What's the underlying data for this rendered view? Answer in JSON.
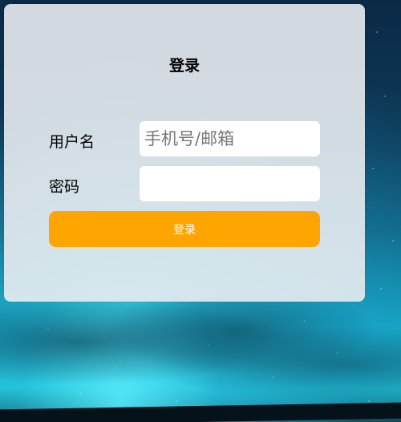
{
  "login_form": {
    "title": "登录",
    "username_label": "用户名",
    "username_placeholder": "手机号/邮箱",
    "username_value": "",
    "password_label": "密码",
    "password_value": "",
    "submit_label": "登录"
  },
  "colors": {
    "accent": "#ffa502",
    "card_background": "#e9ecf1"
  }
}
